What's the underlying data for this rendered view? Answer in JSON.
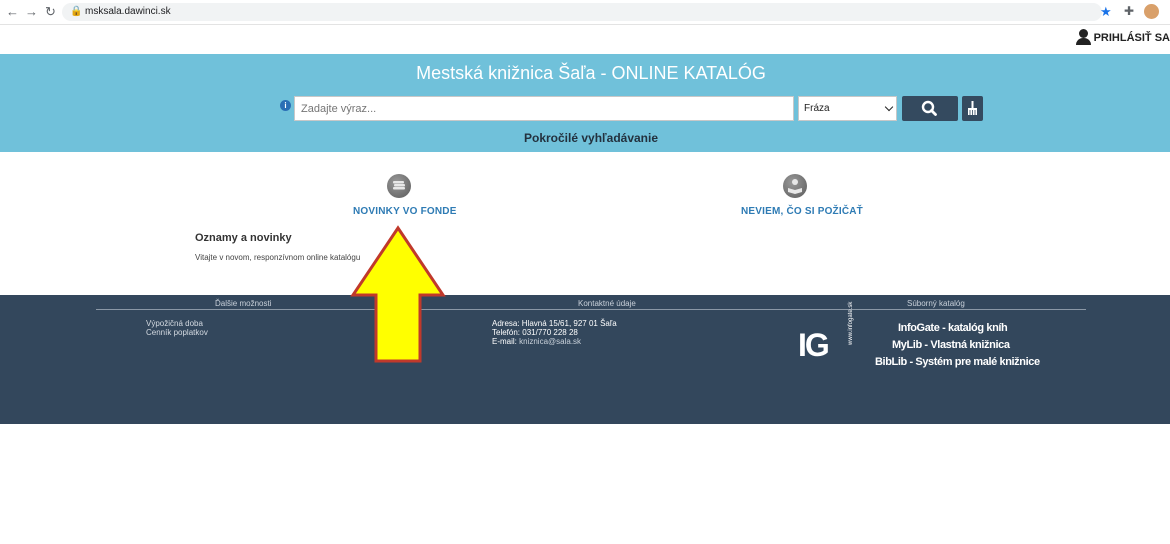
{
  "browser": {
    "url": "msksala.dawinci.sk"
  },
  "header": {
    "login_label": "PRIHLÁSIŤ SA"
  },
  "hero": {
    "title": "Mestská knižnica Šaľa - ONLINE KATALÓG",
    "search_placeholder": "Zadajte výraz...",
    "search_mode": "Fráza",
    "advanced_search": "Pokročilé vyhľadávanie"
  },
  "shortcuts": [
    {
      "label": "NOVINKY VO FONDE",
      "icon": "books-icon"
    },
    {
      "label": "NEVIEM, ČO SI POŽIČAŤ",
      "icon": "reader-icon"
    }
  ],
  "news": {
    "heading": "Oznamy a novinky",
    "text": "Vitajte v novom, responzívnom online katalógu"
  },
  "footer": {
    "col1_heading": "Ďalšie možnosti",
    "col1_links": [
      "Výpožičná doba",
      "Cenník poplatkov"
    ],
    "col2_heading": "Kontaktné údaje",
    "address": "Adresa: Hlavná 15/61, 927 01 Šaľa",
    "phone": "Telefón: 031/770 228 28",
    "email_label": "E-mail:",
    "email": "kniznica@sala.sk",
    "col3_heading": "Súborný katalóg",
    "logo_text": "IG",
    "logo_url": "www.infogate.sk",
    "products": [
      "InfoGate - katalóg kníh",
      "MyLib - Vlastná knižnica",
      "BibLib - Systém pre malé knižnice"
    ]
  },
  "colors": {
    "hero_bg": "#70c1da",
    "footer_bg": "#33475c",
    "link": "#2e7bb4",
    "annotation_arrow": "#ffff00"
  }
}
